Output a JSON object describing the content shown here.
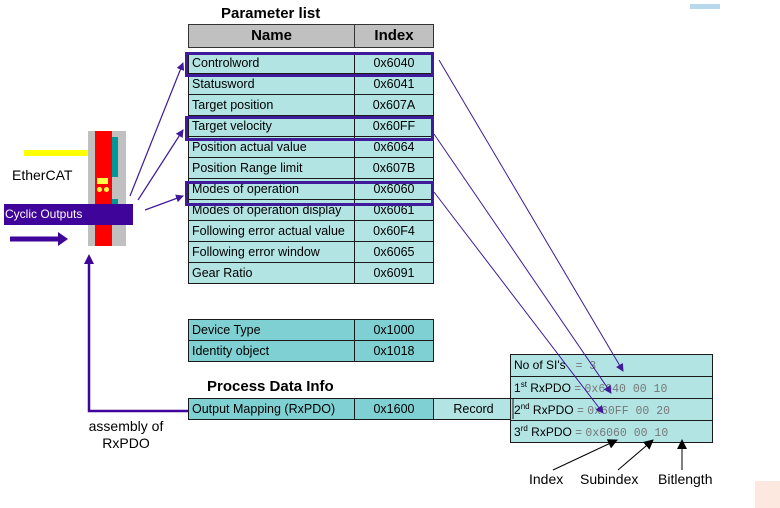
{
  "parameter_list": {
    "title": "Parameter list",
    "headers": [
      "Name",
      "Index"
    ],
    "rows": [
      {
        "name": "Controlword",
        "index": "0x6040",
        "highlighted": true
      },
      {
        "name": "Statusword",
        "index": "0x6041",
        "highlighted": false
      },
      {
        "name": "Target position",
        "index": "0x607A",
        "highlighted": false
      },
      {
        "name": "Target velocity",
        "index": "0x60FF",
        "highlighted": true
      },
      {
        "name": "Position actual value",
        "index": "0x6064",
        "highlighted": false
      },
      {
        "name": "Position Range limit",
        "index": "0x607B",
        "highlighted": false
      },
      {
        "name": "Modes of operation",
        "index": "0x6060",
        "highlighted": true
      },
      {
        "name": "Modes of operation display",
        "index": "0x6061",
        "highlighted": false
      },
      {
        "name": "Following error actual value",
        "index": "0x60F4",
        "highlighted": false
      },
      {
        "name": "Following error window",
        "index": "0x6065",
        "highlighted": false
      },
      {
        "name": "Gear Ratio",
        "index": "0x6091",
        "highlighted": false
      }
    ]
  },
  "device_list": {
    "rows": [
      {
        "name": "Device Type",
        "index": "0x1000"
      },
      {
        "name": "Identity object",
        "index": "0x1018"
      }
    ]
  },
  "process_data_info": {
    "title": "Process Data Info",
    "row": {
      "name": "Output Mapping (RxPDO)",
      "index": "0x1600",
      "type": "Record"
    }
  },
  "rxpdo_table": {
    "rows": [
      {
        "label": "No of SI's",
        "sup": "",
        "suffix": "",
        "eq": "=",
        "value": "3"
      },
      {
        "label": "1",
        "sup": "st",
        "suffix": " RxPDO",
        "eq": "=",
        "value": "0x6040 00 10"
      },
      {
        "label": "2",
        "sup": "nd",
        "suffix": " RxPDO",
        "eq": "=",
        "value": "0x60FF 00 20"
      },
      {
        "label": "3",
        "sup": "rd",
        "suffix": " RxPDO",
        "eq": "=",
        "value": "0x6060 00 10"
      }
    ]
  },
  "annotations": {
    "index": "Index",
    "subindex": "Subindex",
    "bitlength": "Bitlength",
    "ethercat": "EtherCAT",
    "cyclic_outputs": "Cyclic Outputs",
    "assembly_line1": "assembly of",
    "assembly_line2": "RxPDO"
  },
  "colors": {
    "accent_purple": "#3f1a9a",
    "cell_light": "#b2e4e4",
    "cell_dark": "#7fd0d2",
    "header_gray": "#c0c0c0",
    "device_red": "#ff0000",
    "device_teal": "#009999",
    "cable_yellow": "#ffff00"
  }
}
